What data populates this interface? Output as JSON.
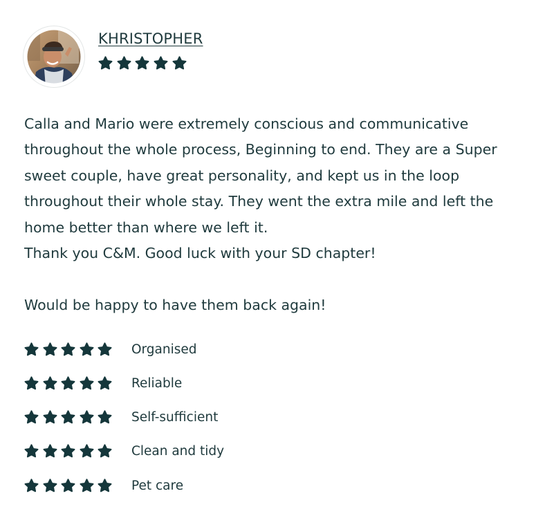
{
  "reviewer": {
    "name": "KHRISTOPHER",
    "rating": 5,
    "max_rating": 5
  },
  "review": {
    "paragraphs": [
      "Calla and Mario were extremely conscious and communicative throughout the whole process, Beginning to end. They are a Super sweet couple, have great personality, and kept us in the loop throughout their whole stay. They went the extra mile and left the home better than where we left it.",
      "Thank you C&M. Good luck with your SD chapter!",
      "",
      "Would be happy to have them back again!"
    ]
  },
  "categories": [
    {
      "label": "Organised",
      "rating": 5
    },
    {
      "label": "Reliable",
      "rating": 5
    },
    {
      "label": "Self-sufficient",
      "rating": 5
    },
    {
      "label": "Clean and tidy",
      "rating": 5
    },
    {
      "label": "Pet care",
      "rating": 5
    }
  ],
  "colors": {
    "text": "#1f3a3d",
    "star": "#15373b"
  },
  "icons": {
    "star": "star-icon",
    "avatar": "avatar"
  }
}
